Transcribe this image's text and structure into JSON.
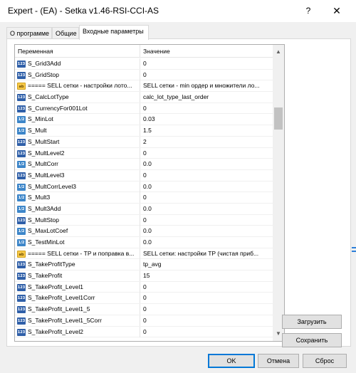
{
  "window": {
    "title": "Expert - (EA) - Setka v1.46-RSI-CCI-AS",
    "help_label": "?",
    "close_label": "✕"
  },
  "tabs": [
    {
      "label": "О программе",
      "active": false
    },
    {
      "label": "Общие",
      "active": false
    },
    {
      "label": "Входные параметры",
      "active": true
    }
  ],
  "grid": {
    "headers": {
      "name": "Переменная",
      "value": "Значение"
    },
    "rows": [
      {
        "type": "int",
        "icon": "int-param-icon",
        "name": "S_Grid3Add",
        "value": "0"
      },
      {
        "type": "int",
        "icon": "int-param-icon",
        "name": "S_GridStop",
        "value": "0"
      },
      {
        "type": "str",
        "icon": "string-param-icon",
        "name": "===== SELL сетки - настройки лото...",
        "value": "SELL сетки - min ордер и множители ло..."
      },
      {
        "type": "enm",
        "icon": "enum-param-icon",
        "name": "S_CalcLotType",
        "value": "calc_lot_type_last_order"
      },
      {
        "type": "int",
        "icon": "int-param-icon",
        "name": "S_CurrencyFor001Lot",
        "value": "0"
      },
      {
        "type": "dbl",
        "icon": "double-param-icon",
        "name": "S_MinLot",
        "value": "0.03"
      },
      {
        "type": "dbl",
        "icon": "double-param-icon",
        "name": "S_Mult",
        "value": "1.5"
      },
      {
        "type": "int",
        "icon": "int-param-icon",
        "name": "S_MultStart",
        "value": "2"
      },
      {
        "type": "int",
        "icon": "int-param-icon",
        "name": "S_MultLevel2",
        "value": "0"
      },
      {
        "type": "dbl",
        "icon": "double-param-icon",
        "name": "S_MultCorr",
        "value": "0.0"
      },
      {
        "type": "int",
        "icon": "int-param-icon",
        "name": "S_MultLevel3",
        "value": "0"
      },
      {
        "type": "dbl",
        "icon": "double-param-icon",
        "name": "S_MultCorrLevel3",
        "value": "0.0"
      },
      {
        "type": "dbl",
        "icon": "double-param-icon",
        "name": "S_Mult3",
        "value": "0"
      },
      {
        "type": "dbl",
        "icon": "double-param-icon",
        "name": "S_Mult3Add",
        "value": "0.0"
      },
      {
        "type": "int",
        "icon": "int-param-icon",
        "name": "S_MultStop",
        "value": "0"
      },
      {
        "type": "dbl",
        "icon": "double-param-icon",
        "name": "S_MaxLotCoef",
        "value": "0.0"
      },
      {
        "type": "dbl",
        "icon": "double-param-icon",
        "name": "S_TestMinLot",
        "value": "0.0"
      },
      {
        "type": "str",
        "icon": "string-param-icon",
        "name": "===== SELL сетки - TP и поправка в...",
        "value": "SELL сетки: настройки TP (чистая приб..."
      },
      {
        "type": "enm",
        "icon": "enum-param-icon",
        "name": "S_TakeProfitType",
        "value": "tp_avg"
      },
      {
        "type": "int",
        "icon": "int-param-icon",
        "name": "S_TakeProfit",
        "value": "15"
      },
      {
        "type": "int",
        "icon": "int-param-icon",
        "name": "S_TakeProfit_Level1",
        "value": "0"
      },
      {
        "type": "int",
        "icon": "int-param-icon",
        "name": "S_TakeProfit_Level1Corr",
        "value": "0"
      },
      {
        "type": "int",
        "icon": "int-param-icon",
        "name": "S_TakeProfit_Level1_5",
        "value": "0"
      },
      {
        "type": "int",
        "icon": "int-param-icon",
        "name": "S_TakeProfit_Level1_5Corr",
        "value": "0"
      },
      {
        "type": "int",
        "icon": "int-param-icon",
        "name": "S_TakeProfit_Level2",
        "value": "0"
      }
    ]
  },
  "icon_text": {
    "int": "123",
    "dbl": "1/2",
    "str": "ab",
    "enm": "123"
  },
  "scrollbar": {
    "up_icon": "▲",
    "down_icon": "▼"
  },
  "side_buttons": {
    "load": "Загрузить",
    "save": "Сохранить"
  },
  "buttons": {
    "ok": "OK",
    "cancel": "Отмена",
    "reset": "Сброс"
  }
}
